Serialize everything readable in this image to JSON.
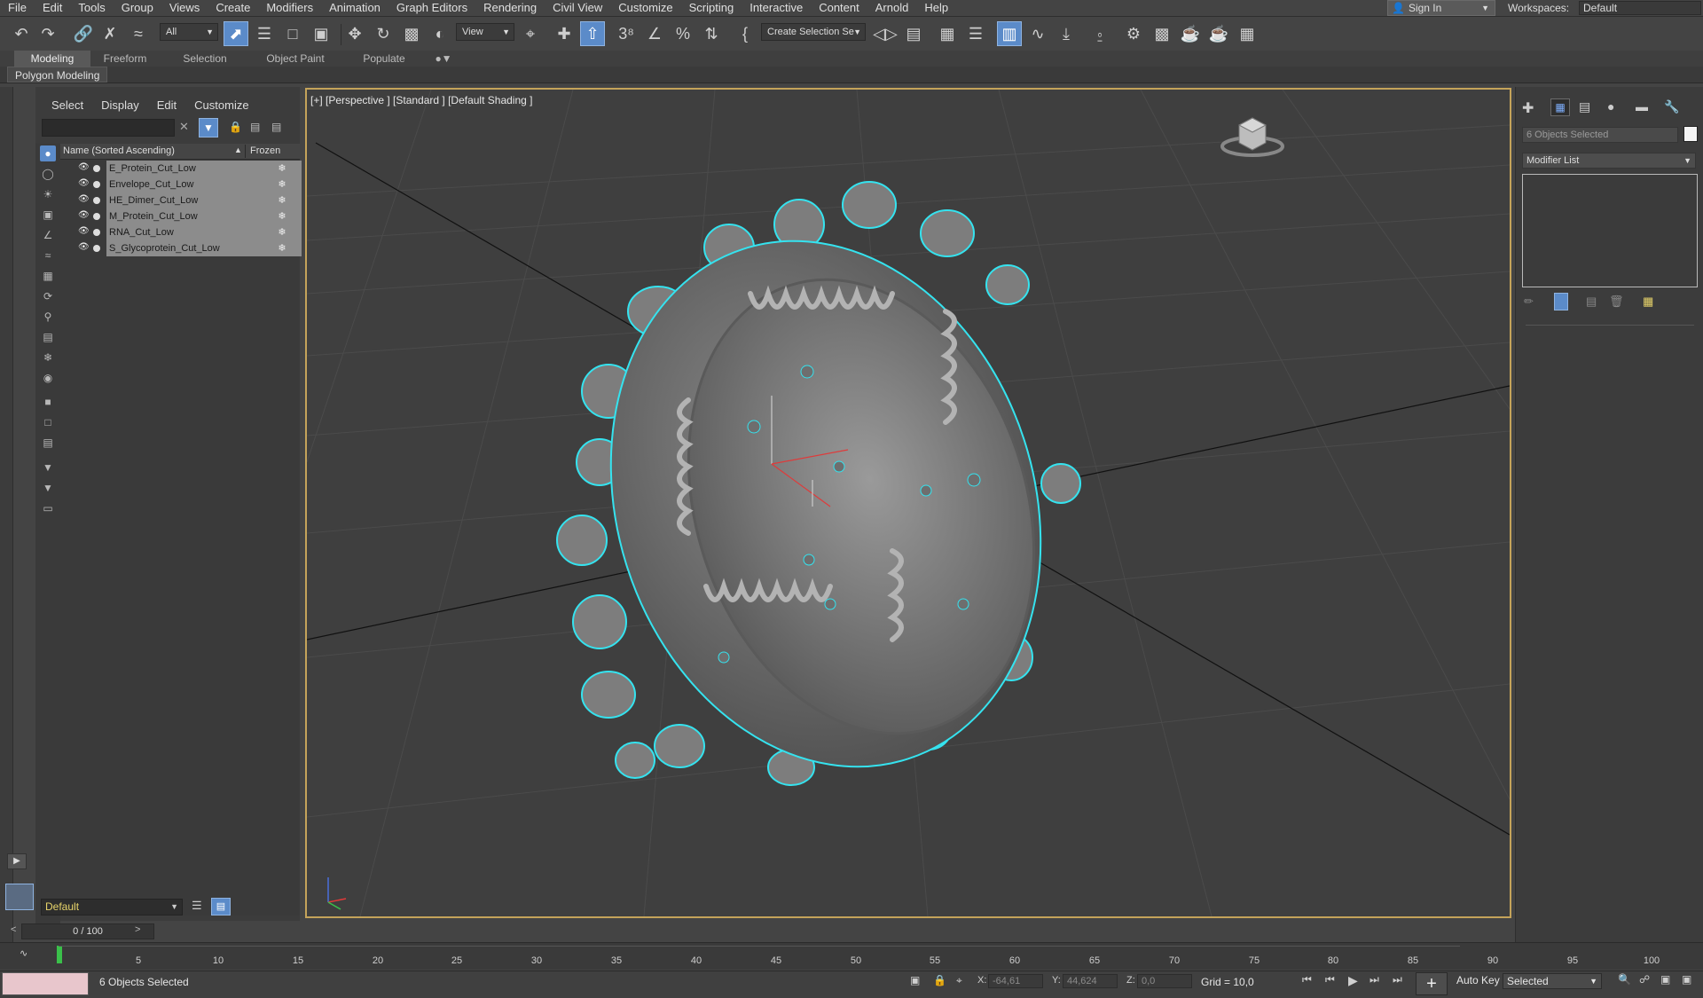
{
  "menu": [
    "File",
    "Edit",
    "Tools",
    "Group",
    "Views",
    "Create",
    "Modifiers",
    "Animation",
    "Graph Editors",
    "Rendering",
    "Civil View",
    "Customize",
    "Scripting",
    "Interactive",
    "Content",
    "Arnold",
    "Help"
  ],
  "account": {
    "sign_in": "Sign In",
    "workspaces_label": "Workspaces:",
    "workspace": "Default"
  },
  "toolbar": {
    "filter_value": "All",
    "ref_coord": "View",
    "named_selection": "Create Selection Se"
  },
  "ribbon": {
    "tabs": [
      "Modeling",
      "Freeform",
      "Selection",
      "Object Paint",
      "Populate"
    ],
    "active_tab": "Modeling",
    "panel": "Polygon Modeling"
  },
  "scene_explorer": {
    "menu": [
      "Select",
      "Display",
      "Edit",
      "Customize"
    ],
    "columns": {
      "name": "Name (Sorted Ascending)",
      "frozen": "Frozen"
    },
    "sort_indicator": "▲",
    "objects": [
      "E_Protein_Cut_Low",
      "Envelope_Cut_Low",
      "HE_Dimer_Cut_Low",
      "M_Protein_Cut_Low",
      "RNA_Cut_Low",
      "S_Glycoprotein_Cut_Low"
    ],
    "layer": "Default"
  },
  "viewport": {
    "label": "[+] [Perspective ] [Standard ] [Default Shading ]"
  },
  "command_panel": {
    "selection": "6 Objects Selected",
    "modifier_list": "Modifier List"
  },
  "timeline": {
    "frame": "0 / 100",
    "ticks": [
      "5",
      "10",
      "15",
      "20",
      "25",
      "30",
      "35",
      "40",
      "45",
      "50",
      "55",
      "60",
      "65",
      "70",
      "75",
      "80",
      "85",
      "90",
      "95",
      "100"
    ]
  },
  "status": {
    "message": "6 Objects Selected",
    "x_label": "X:",
    "x_value": "-64,61",
    "y_label": "Y:",
    "y_value": "44,624",
    "z_label": "Z:",
    "z_value": "0,0",
    "grid": "Grid = 10,0",
    "auto_key": "Auto Key",
    "key_mode": "Selected"
  },
  "colors": {
    "accent": "#5b8bc9",
    "selection_outline": "#35e3ef",
    "viewport_border": "#c4a35a",
    "layer_text": "#e8d46a"
  }
}
